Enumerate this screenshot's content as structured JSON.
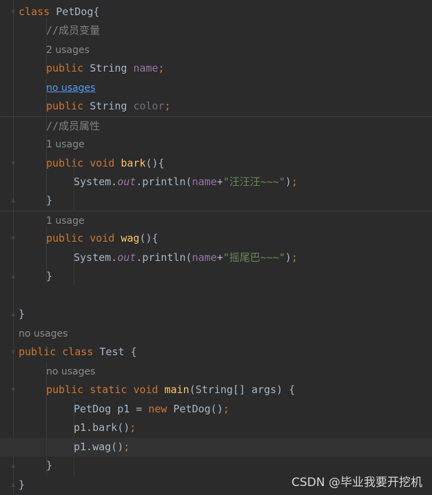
{
  "editor": {
    "lines": [
      {
        "type": "code",
        "tokens": [
          [
            "kw",
            "class "
          ],
          [
            "punc",
            "PetDog{"
          ]
        ]
      },
      {
        "type": "code",
        "indent": 1,
        "tokens": [
          [
            "cmt",
            "//成员变量"
          ]
        ]
      },
      {
        "type": "hint",
        "indent": 1,
        "text": "2 usages"
      },
      {
        "type": "code",
        "indent": 1,
        "tokens": [
          [
            "kw",
            "public "
          ],
          [
            "punc",
            "String "
          ],
          [
            "field",
            "name"
          ],
          [
            "semi",
            ";"
          ]
        ]
      },
      {
        "type": "hint",
        "indent": 1,
        "text": "no usages",
        "link": true
      },
      {
        "type": "code",
        "indent": 1,
        "tokens": [
          [
            "kw",
            "public "
          ],
          [
            "punc",
            "String "
          ],
          [
            "field-dim",
            "color"
          ],
          [
            "semi",
            ";"
          ]
        ]
      },
      {
        "type": "code",
        "indent": 1,
        "sep": true,
        "tokens": [
          [
            "cmt",
            "//成员属性"
          ]
        ]
      },
      {
        "type": "hint",
        "indent": 1,
        "text": "1 usage"
      },
      {
        "type": "code",
        "indent": 1,
        "tokens": [
          [
            "kw",
            "public "
          ],
          [
            "kw",
            "void "
          ],
          [
            "fn",
            "bark"
          ],
          [
            "punc",
            "(){"
          ]
        ]
      },
      {
        "type": "code",
        "indent": 2,
        "tokens": [
          [
            "punc",
            "System."
          ],
          [
            "field-i",
            "out"
          ],
          [
            "punc",
            ".println("
          ],
          [
            "field",
            "name"
          ],
          [
            "punc",
            "+"
          ],
          [
            "str",
            "\"汪汪汪~~~\""
          ],
          [
            "punc",
            ")"
          ],
          [
            "semi",
            ";"
          ]
        ]
      },
      {
        "type": "code",
        "indent": 1,
        "tokens": [
          [
            "punc",
            "}"
          ]
        ]
      },
      {
        "type": "hint",
        "indent": 1,
        "sep": true,
        "text": "1 usage"
      },
      {
        "type": "code",
        "indent": 1,
        "tokens": [
          [
            "kw",
            "public "
          ],
          [
            "kw",
            "void "
          ],
          [
            "fn",
            "wag"
          ],
          [
            "punc",
            "(){"
          ]
        ]
      },
      {
        "type": "code",
        "indent": 2,
        "tokens": [
          [
            "punc",
            "System."
          ],
          [
            "field-i",
            "out"
          ],
          [
            "punc",
            ".println("
          ],
          [
            "field",
            "name"
          ],
          [
            "punc",
            "+"
          ],
          [
            "str",
            "\"摇尾巴~~~\""
          ],
          [
            "punc",
            ")"
          ],
          [
            "semi",
            ";"
          ]
        ]
      },
      {
        "type": "code",
        "indent": 1,
        "tokens": [
          [
            "punc",
            "}"
          ]
        ]
      },
      {
        "type": "code",
        "indent": 0,
        "tokens": []
      },
      {
        "type": "code",
        "indent": 0,
        "tokens": [
          [
            "punc",
            "}"
          ]
        ]
      },
      {
        "type": "hint",
        "indent": 0,
        "text": "no usages"
      },
      {
        "type": "code",
        "indent": 0,
        "tokens": [
          [
            "kw",
            "public "
          ],
          [
            "kw",
            "class "
          ],
          [
            "punc",
            "Test {"
          ]
        ]
      },
      {
        "type": "hint",
        "indent": 1,
        "text": "no usages"
      },
      {
        "type": "code",
        "indent": 1,
        "tokens": [
          [
            "kw",
            "public "
          ],
          [
            "kw",
            "static "
          ],
          [
            "kw",
            "void "
          ],
          [
            "fn",
            "main"
          ],
          [
            "punc",
            "(String[] args) {"
          ]
        ]
      },
      {
        "type": "code",
        "indent": 2,
        "tokens": [
          [
            "punc",
            "PetDog p1 = "
          ],
          [
            "kw",
            "new "
          ],
          [
            "punc",
            "PetDog()"
          ],
          [
            "semi",
            ";"
          ]
        ]
      },
      {
        "type": "code",
        "indent": 2,
        "tokens": [
          [
            "punc",
            "p1.bark()"
          ],
          [
            "semi",
            ";"
          ]
        ]
      },
      {
        "type": "code",
        "indent": 2,
        "current": true,
        "tokens": [
          [
            "punc",
            "p1.wag()"
          ],
          [
            "semi",
            ";"
          ]
        ]
      },
      {
        "type": "code",
        "indent": 1,
        "tokens": [
          [
            "punc",
            "}"
          ]
        ]
      },
      {
        "type": "code",
        "indent": 0,
        "tokens": [
          [
            "punc",
            "}"
          ]
        ]
      }
    ]
  },
  "colors": {
    "background": "#2b2b2b",
    "keyword": "#cc7832",
    "method": "#ffc66d",
    "field": "#9876aa",
    "string": "#6a8759",
    "comment": "#808080",
    "text": "#a9b7c6",
    "hint": "#8c8c8c",
    "link": "#589df6"
  },
  "icons": [
    "fold-open-icon",
    "fold-close-icon"
  ],
  "watermark": "CSDN @毕业我要开挖机"
}
